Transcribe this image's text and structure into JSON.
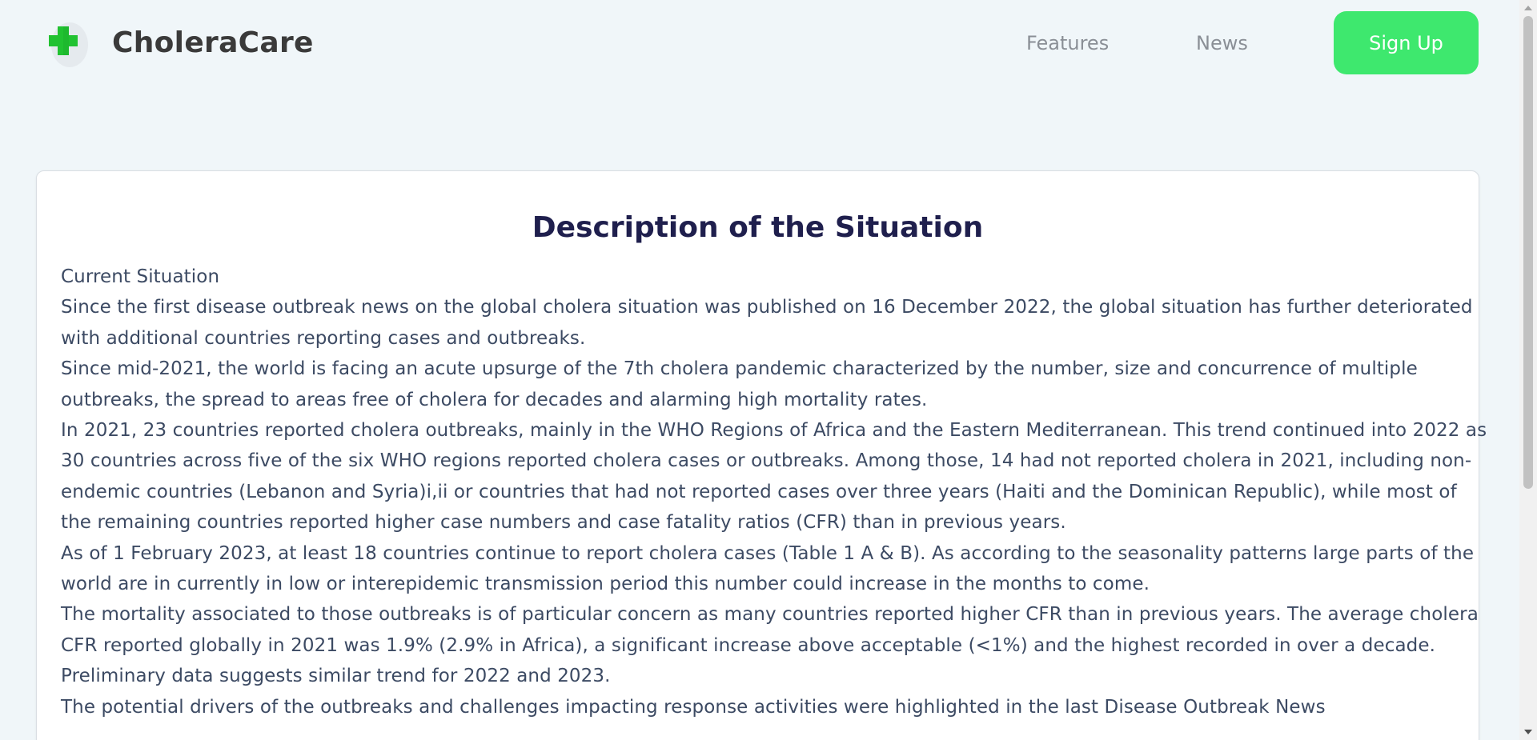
{
  "header": {
    "brand": "CholeraCare",
    "nav": {
      "features_label": "Features",
      "news_label": "News"
    },
    "signup_label": "Sign Up",
    "logo_icon": "green-cross-icon"
  },
  "colors": {
    "background": "#f0f6f9",
    "accent": "#3ee86e",
    "logo_green": "#21c231",
    "title_color": "#1f1f4d",
    "body_text": "#3c4a63"
  },
  "article": {
    "title": "Description of the Situation",
    "paragraphs": [
      "Current Situation",
      "Since the first disease outbreak news on the global cholera situation was published on 16 December 2022, the global situation has further deteriorated with additional countries reporting cases and outbreaks.",
      "Since mid-2021, the world is facing an acute upsurge of the 7th cholera pandemic characterized by the number, size and concurrence of multiple outbreaks, the spread to areas free of cholera for decades and alarming high mortality rates.",
      "In 2021, 23 countries reported cholera outbreaks, mainly in the WHO Regions of Africa and the Eastern Mediterranean. This trend continued into 2022 as 30 countries across five of the six WHO regions reported cholera cases or outbreaks. Among those, 14 had not reported cholera in 2021, including non-endemic countries (Lebanon and Syria)i,ii or countries that had not reported cases over three years (Haiti and the Dominican Republic), while most of the remaining countries reported higher case numbers and case fatality ratios (CFR) than in previous years.",
      "As of 1 February 2023, at least 18 countries continue to report cholera cases (Table 1 A & B). As according to the seasonality patterns large parts of the world are in currently in low or interepidemic transmission period this number could increase in the months to come.",
      "The mortality associated to those outbreaks is of particular concern as many countries reported higher CFR than in previous years. The average cholera CFR reported globally in 2021 was 1.9% (2.9% in Africa), a significant increase above acceptable (<1%) and the highest recorded in over a decade. Preliminary data suggests similar trend for 2022 and 2023.",
      "The potential drivers of the outbreaks and challenges impacting response activities were highlighted in the last Disease Outbreak News"
    ]
  },
  "scrollbar": {
    "up_icon": "scroll-up-arrow-icon",
    "down_icon": "scroll-down-arrow-icon"
  }
}
